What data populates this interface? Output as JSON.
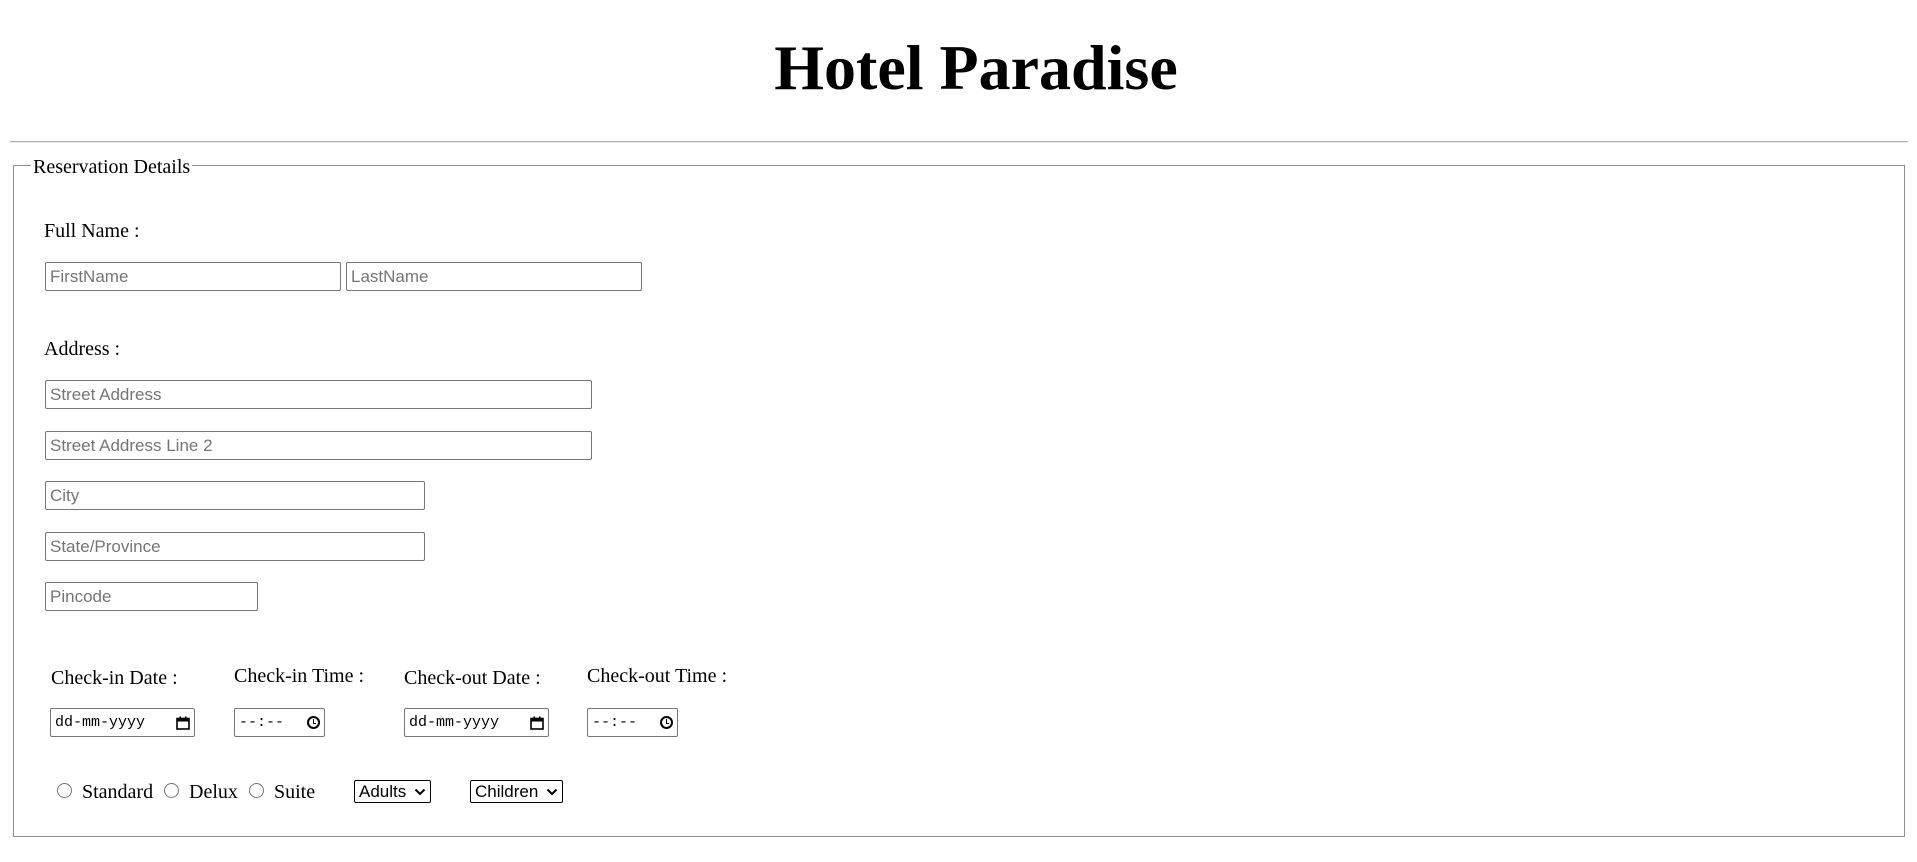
{
  "header": {
    "title": "Hotel Paradise"
  },
  "form": {
    "legend": "Reservation Details",
    "full_name": {
      "label": "Full Name :",
      "first_placeholder": "FirstName",
      "last_placeholder": "LastName"
    },
    "address": {
      "label": "Address :",
      "street_placeholder": "Street Address",
      "street2_placeholder": "Street Address Line 2",
      "city_placeholder": "City",
      "state_placeholder": "State/Province",
      "pincode_placeholder": "Pincode"
    },
    "checkin_date": {
      "label": "Check-in Date :",
      "placeholder": "dd-mm-yyyy",
      "icon": "calendar-icon"
    },
    "checkin_time": {
      "label": "Check-in Time :",
      "placeholder": "--:--",
      "icon": "clock-icon"
    },
    "checkout_date": {
      "label": "Check-out Date :",
      "placeholder": "dd-mm-yyyy",
      "icon": "calendar-icon"
    },
    "checkout_time": {
      "label": "Check-out Time :",
      "placeholder": "--:--",
      "icon": "clock-icon"
    },
    "room_types": [
      {
        "label": "Standard",
        "checked": false
      },
      {
        "label": "Delux",
        "checked": false
      },
      {
        "label": "Suite",
        "checked": false
      }
    ],
    "adults_select": {
      "selected": "Adults"
    },
    "children_select": {
      "selected": "Children"
    }
  }
}
